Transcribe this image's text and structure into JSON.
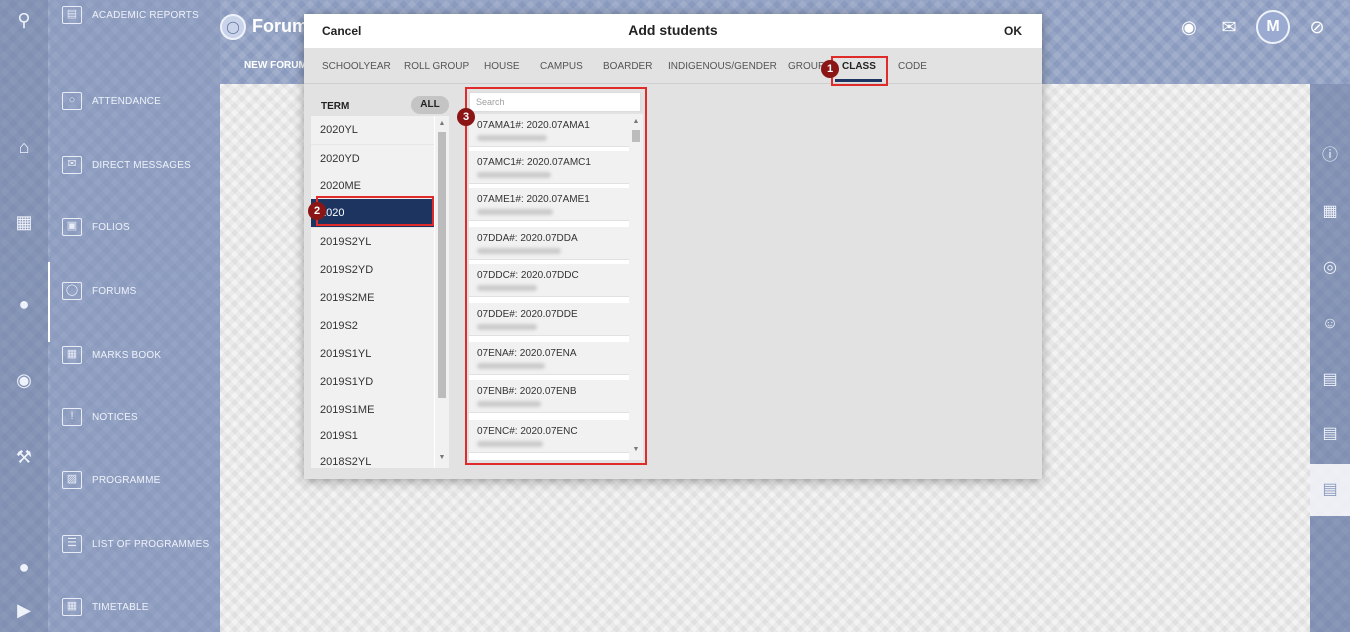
{
  "app": {
    "section_title": "Forums",
    "sub_nav": "NEW FORUM..."
  },
  "nav": {
    "items": [
      {
        "label": "ACADEMIC REPORTS",
        "icon": "reports-icon"
      },
      {
        "label": "ATTENDANCE",
        "icon": "attendance-icon"
      },
      {
        "label": "DIRECT MESSAGES",
        "icon": "message-icon"
      },
      {
        "label": "FOLIOS",
        "icon": "folder-icon"
      },
      {
        "label": "FORUMS",
        "icon": "forum-icon"
      },
      {
        "label": "MARKS BOOK",
        "icon": "marksbook-icon"
      },
      {
        "label": "NOTICES",
        "icon": "notice-icon"
      },
      {
        "label": "PROGRAMME",
        "icon": "programme-icon"
      },
      {
        "label": "LIST OF PROGRAMMES",
        "icon": "list-icon"
      },
      {
        "label": "TIMETABLE",
        "icon": "timetable-icon"
      }
    ]
  },
  "header": {
    "avatar_letter": "M"
  },
  "modal": {
    "cancel": "Cancel",
    "title": "Add students",
    "ok": "OK",
    "tabs": [
      {
        "label": "SCHOOLYEAR"
      },
      {
        "label": "ROLL GROUP"
      },
      {
        "label": "HOUSE"
      },
      {
        "label": "CAMPUS"
      },
      {
        "label": "BOARDER"
      },
      {
        "label": "INDIGENOUS/GENDER"
      },
      {
        "label": "GROUP"
      },
      {
        "label": "CLASS"
      },
      {
        "label": "CODE"
      }
    ],
    "active_tab": "CLASS",
    "term_header": "TERM",
    "all_button": "ALL",
    "terms": [
      "2020YL",
      "2020YD",
      "2020ME",
      "2020",
      "2019S2YL",
      "2019S2YD",
      "2019S2ME",
      "2019S2",
      "2019S1YL",
      "2019S1YD",
      "2019S1ME",
      "2019S1",
      "2018S2YL"
    ],
    "selected_term": "2020",
    "search_placeholder": "Search",
    "classes": [
      "07AMA1#: 2020.07AMA1",
      "07AMC1#: 2020.07AMC1",
      "07AME1#: 2020.07AME1",
      "07DDA#: 2020.07DDA",
      "07DDC#: 2020.07DDC",
      "07DDE#: 2020.07DDE",
      "07ENA#: 2020.07ENA",
      "07ENB#: 2020.07ENB",
      "07ENC#: 2020.07ENC"
    ]
  },
  "annotations": [
    "1",
    "2",
    "3"
  ],
  "colors": {
    "accent": "#1d3461",
    "annotation": "#e02b2b",
    "badge": "#8b1515"
  }
}
